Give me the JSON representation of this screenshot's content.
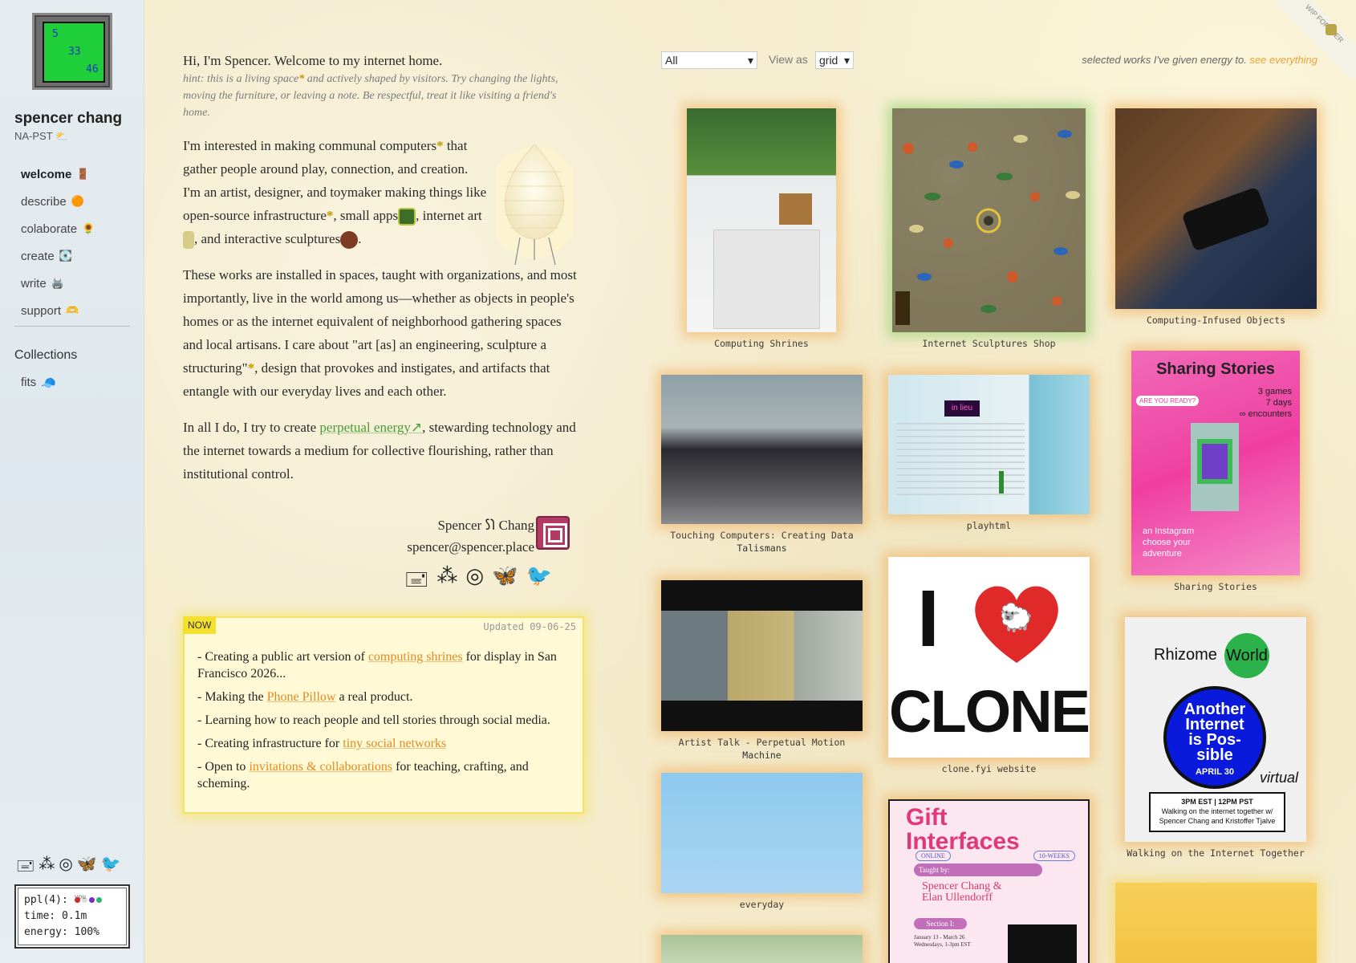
{
  "sidebar": {
    "avatar_numbers": [
      "5",
      "33",
      "46"
    ],
    "name": "spencer chang",
    "timezone": "NA-PST",
    "timezone_icon": "⛅",
    "nav": [
      {
        "label": "welcome",
        "icon": "🚪",
        "active": true
      },
      {
        "label": "describe",
        "icon": "🟠"
      },
      {
        "label": "colaborate",
        "icon": "🌻"
      },
      {
        "label": "create",
        "icon": "💽"
      },
      {
        "label": "write",
        "icon": "🖨️"
      },
      {
        "label": "support",
        "icon": "🫶"
      }
    ],
    "collections_title": "Collections",
    "collections": [
      {
        "label": "fits",
        "icon": "🧢"
      }
    ],
    "social_icons": [
      "🖃",
      "⁂",
      "◎",
      "🦋",
      "🐦"
    ],
    "status": {
      "ppl_label": "ppl(4):",
      "you_label": "you",
      "dot_colors": [
        "#d22",
        "#ddd",
        "#7a2cc7",
        "#2bb673"
      ],
      "time_label": "time:",
      "time_value": "0.1m",
      "energy_label": "energy:",
      "energy_value": "100%"
    }
  },
  "intro": {
    "greeting": "Hi, I'm Spencer. Welcome to my internet home.",
    "hint_a": "hint: this is a living space",
    "hint_b": " and actively shaped by visitors. Try changing the lights, moving the furniture, or leaving a note. Be respectful, treat it like visiting a friend's home.",
    "p1_a": "I'm interested in making communal computers",
    "p1_b": " that gather people around play, connection, and creation. I'm an artist, designer, and toymaker making things like open-source infrastructure",
    "p1_c": ", small apps",
    "p1_d": ", internet art",
    "p1_e": ", and interactive sculptures",
    "p1_f": ".",
    "p2_a": "These works are installed in spaces, taught with organizations, and most importantly, live in the world among us—whether as objects in people's homes or as the internet equivalent of neighborhood gathering spaces and local artisans. I care about \"art [as] an engineering, sculpture a structuring\"",
    "p2_b": ", design that provokes and instigates, and artifacts that entangle with our everyday lives and each other.",
    "p3_a": "In all I do, I try to create ",
    "p3_link": "perpetual energy↗",
    "p3_b": ", stewarding technology and the internet towards a medium for collective flourishing, rather than institutional control.",
    "star": "*",
    "signature_name": "Spencer 𐑕𐑐 Chang",
    "signature_email": "spencer@spencer.place",
    "social_icons": [
      "🖃",
      "⁂",
      "◎",
      "🦋",
      "🐦"
    ]
  },
  "now": {
    "badge": "NOW",
    "updated": "Updated 09-06-25",
    "items": [
      {
        "pre": "- Creating a public art version of ",
        "link": "computing shrines",
        "post": " for display in San Francisco 2026..."
      },
      {
        "pre": "- Making the ",
        "link": "Phone Pillow",
        "post": " a real product."
      },
      {
        "pre": "- Learning how to reach people and tell stories through social media.",
        "link": "",
        "post": ""
      },
      {
        "pre": "- Creating infrastructure for ",
        "link": "tiny social networks",
        "post": ""
      },
      {
        "pre": "- Open to ",
        "link": "invitations & collaborations",
        "post": " for teaching, crafting, and scheming."
      }
    ]
  },
  "works": {
    "filter_value": "All",
    "view_label": "View as",
    "view_value": "grid",
    "note": "selected works I've given energy to.",
    "note_link": "see everything",
    "wip": "WIP FOREVER",
    "tiles": [
      {
        "caption": "Computing Shrines"
      },
      {
        "caption": "Internet Sculptures Shop"
      },
      {
        "caption": "Computing-Infused Objects"
      },
      {
        "caption": "Touching Computers: Creating Data Talismans"
      },
      {
        "caption": "playhtml"
      },
      {
        "caption": "Sharing Stories"
      },
      {
        "caption": "Artist Talk - Perpetual Motion Machine"
      },
      {
        "caption": "clone.fyi website"
      },
      {
        "caption": "Walking on the Internet Together"
      },
      {
        "caption": "everyday"
      }
    ],
    "sharing": {
      "title": "Sharing Stories",
      "l1": "3 games",
      "l2": "7 days",
      "l3": "∞ encounters",
      "tag": "ARE YOU READY?",
      "b1": "an Instagram",
      "b2": "choose your",
      "b3": "adventure"
    },
    "clone": {
      "i": "I",
      "heart": "🐑",
      "word": "CLONE"
    },
    "rhizome": {
      "brand": "Rhizome",
      "world": "World",
      "c1": "Another",
      "c2": "Internet",
      "c3": "is Pos-",
      "c4": "sible",
      "date": "APRIL 30",
      "virtual": "virtual",
      "time": "3PM EST | 12PM PST",
      "desc1": "Walking on the internet together w/",
      "desc2": "Spencer Chang and Kristoffer Tjalve"
    },
    "gift": {
      "t1": "Gift",
      "t2": "Interfaces",
      "online": "ONLINE",
      "weeks": "10-WEEKS",
      "taught": "Taught by:",
      "names1": "Spencer Chang &",
      "names2": "Elan Ullendorff",
      "section": "Section I:",
      "d1": "January 13 - March 26",
      "d2": "Wednesdays, 1-3pm EST"
    },
    "playhtml_badge": "in lieu"
  }
}
